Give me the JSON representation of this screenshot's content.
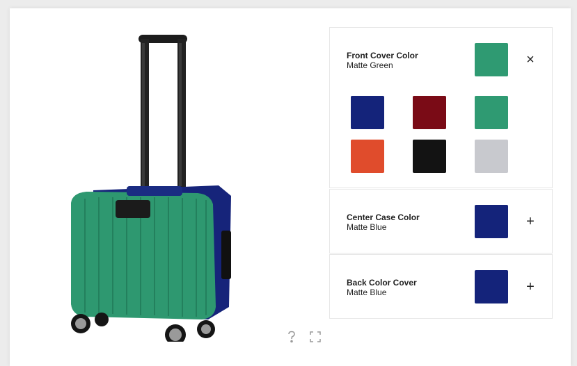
{
  "panels": [
    {
      "title": "Front Cover Color",
      "value": "Matte Green",
      "color": "#2f9a72",
      "toggle": "×",
      "expanded": true,
      "swatches": [
        {
          "name": "blue",
          "color": "#14237a"
        },
        {
          "name": "red",
          "color": "#7a0b16"
        },
        {
          "name": "green",
          "color": "#2f9a72"
        },
        {
          "name": "orange",
          "color": "#e04c2c"
        },
        {
          "name": "black",
          "color": "#131313"
        },
        {
          "name": "grey",
          "color": "#c8c9ce"
        }
      ]
    },
    {
      "title": "Center Case Color",
      "value": "Matte Blue",
      "color": "#14237a",
      "toggle": "+",
      "expanded": false
    },
    {
      "title": "Back Color Cover",
      "value": "Matte Blue",
      "color": "#14237a",
      "toggle": "+",
      "expanded": false
    }
  ],
  "viewer": {
    "tools": [
      {
        "name": "help-icon"
      },
      {
        "name": "fullscreen-icon"
      }
    ]
  }
}
